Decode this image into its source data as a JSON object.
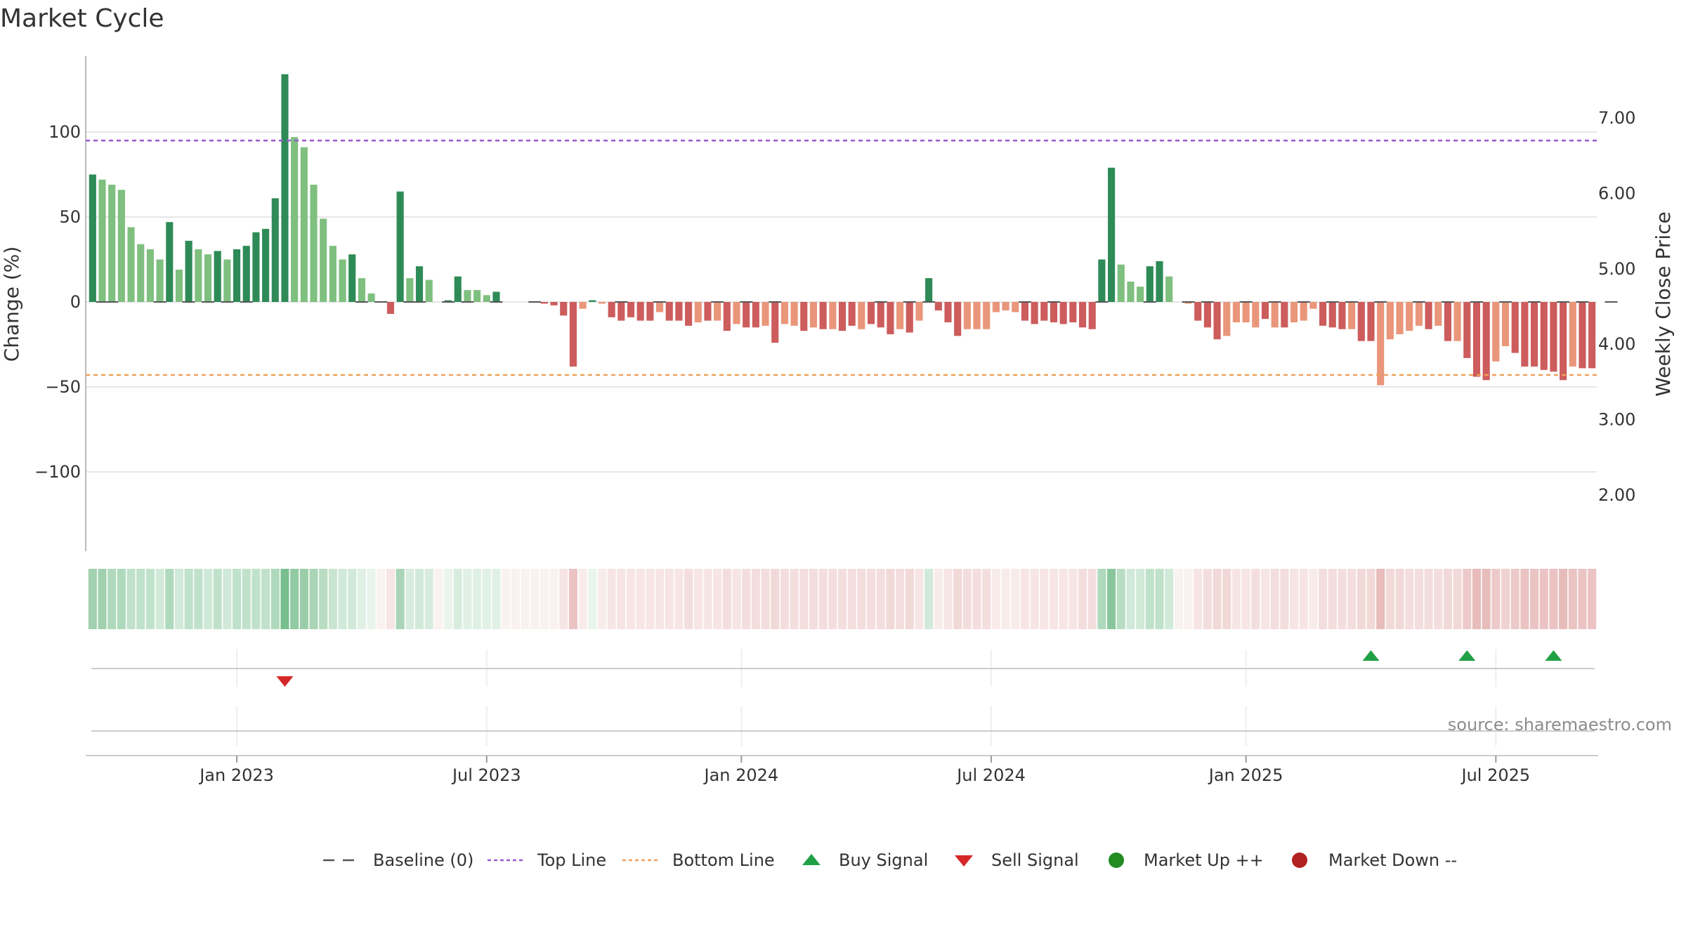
{
  "title": "Market Cycle",
  "source": "source: sharemaestro.com",
  "colors": {
    "up_strong": "#2e8b57",
    "up_light": "#7fbf7f",
    "down_strong": "#cd5c5c",
    "down_light": "#e9967a",
    "top_line": "#9b59d0",
    "bottom_line": "#f0a05a",
    "buy": "#22a046",
    "sell": "#d62728",
    "market_up": "#228b22",
    "market_down": "#b22222"
  },
  "legend": [
    {
      "key": "baseline",
      "label": "Baseline (0)"
    },
    {
      "key": "top",
      "label": "Top Line"
    },
    {
      "key": "bottom",
      "label": "Bottom Line"
    },
    {
      "key": "buy",
      "label": "Buy Signal"
    },
    {
      "key": "sell",
      "label": "Sell Signal"
    },
    {
      "key": "mup",
      "label": "Market Up ++"
    },
    {
      "key": "mdown",
      "label": "Market Down --"
    }
  ],
  "chart_data": {
    "type": "bar",
    "title": "Market Cycle",
    "ylabel": "Change (%)",
    "y2label": "Weekly Close Price",
    "ylim": [
      -145,
      145
    ],
    "y2lim": [
      1.27,
      7.47
    ],
    "yticks": [
      100,
      50,
      0,
      -50,
      -100
    ],
    "ytick_labels": [
      "100",
      "50",
      "0",
      "−50",
      "−100"
    ],
    "y2ticks": [
      7,
      6,
      5,
      4,
      3,
      2
    ],
    "y2tick_labels": [
      "7.00",
      "6.00",
      "5.00",
      "4.00",
      "3.00",
      "2.00"
    ],
    "xtick_labels": [
      "Jan 2023",
      "Jul 2023",
      "Jan 2024",
      "Jul 2024",
      "Jan 2025",
      "Jul 2025"
    ],
    "xtick_weeks": [
      15,
      41,
      67.5,
      93.5,
      120,
      146
    ],
    "top_line": 95,
    "bottom_line": -43,
    "grid": true,
    "legend_position": "bottom",
    "weekly_change": [
      75,
      72,
      69,
      66,
      44,
      34,
      31,
      25,
      47,
      19,
      36,
      31,
      28,
      30,
      25,
      31,
      33,
      41,
      43,
      61,
      134,
      97,
      91,
      69,
      49,
      33,
      25,
      28,
      14,
      5,
      0,
      -7,
      65,
      14,
      21,
      13,
      0,
      1,
      15,
      7,
      7,
      4,
      6,
      0,
      0,
      0,
      0,
      -1,
      -2,
      -8,
      -38,
      -4,
      1,
      -1,
      -9,
      -11,
      -9,
      -11,
      -11,
      -6,
      -11,
      -11,
      -14,
      -12,
      -11,
      -11,
      -17,
      -13,
      -15,
      -15,
      -14,
      -24,
      -13,
      -14,
      -17,
      -15,
      -16,
      -16,
      -17,
      -14,
      -16,
      -13,
      -15,
      -19,
      -16,
      -18,
      -11,
      14,
      -5,
      -12,
      -20,
      -16,
      -16,
      -16,
      -6,
      -5,
      -6,
      -11,
      -13,
      -11,
      -12,
      -13,
      -12,
      -15,
      -16,
      25,
      79,
      22,
      12,
      9,
      21,
      24,
      15,
      0,
      -1,
      -11,
      -15,
      -22,
      -20,
      -12,
      -12,
      -15,
      -10,
      -15,
      -15,
      -12,
      -11,
      -4,
      -14,
      -15,
      -16,
      -16,
      -23,
      -23,
      -49,
      -22,
      -19,
      -17,
      -14,
      -16,
      -14,
      -23,
      -23,
      -33,
      -44,
      -46,
      -35,
      -26,
      -30,
      -38,
      -38,
      -40,
      -41,
      -46,
      -38,
      -39,
      -39
    ],
    "strong_flags": [
      1,
      0,
      0,
      0,
      0,
      0,
      0,
      0,
      1,
      0,
      1,
      0,
      0,
      1,
      0,
      1,
      1,
      1,
      1,
      1,
      1,
      0,
      0,
      0,
      0,
      0,
      0,
      1,
      0,
      0,
      0,
      1,
      1,
      0,
      1,
      0,
      0,
      1,
      1,
      0,
      0,
      0,
      1,
      0,
      0,
      0,
      0,
      1,
      1,
      1,
      1,
      0,
      1,
      0,
      1,
      1,
      1,
      1,
      1,
      0,
      1,
      1,
      1,
      0,
      1,
      0,
      1,
      0,
      1,
      1,
      0,
      1,
      0,
      0,
      1,
      0,
      1,
      0,
      1,
      1,
      0,
      1,
      1,
      1,
      0,
      1,
      0,
      1,
      1,
      1,
      1,
      0,
      0,
      0,
      0,
      0,
      0,
      1,
      1,
      1,
      1,
      1,
      1,
      1,
      1,
      1,
      1,
      0,
      0,
      0,
      1,
      1,
      0,
      0,
      0,
      1,
      1,
      1,
      0,
      0,
      0,
      0,
      1,
      0,
      1,
      0,
      0,
      0,
      1,
      1,
      1,
      0,
      1,
      1,
      0,
      0,
      0,
      0,
      0,
      1,
      0,
      1,
      0,
      1,
      1,
      1,
      0,
      0,
      1,
      1,
      1,
      1,
      1,
      1,
      0,
      1,
      1,
      1
    ],
    "baseline_marks": [
      1,
      2,
      7,
      10,
      12,
      14,
      16,
      28,
      30,
      33,
      34,
      37,
      39,
      42,
      46,
      55,
      59,
      65,
      68,
      71,
      82,
      85,
      87,
      97,
      100,
      105,
      110,
      114,
      116,
      120,
      123,
      126,
      129,
      131,
      134,
      138,
      141,
      144,
      147,
      150,
      153,
      155,
      158
    ],
    "heatmap_intensity": [
      0.6,
      0.6,
      0.5,
      0.5,
      0.4,
      0.4,
      0.4,
      0.3,
      0.5,
      0.3,
      0.4,
      0.4,
      0.3,
      0.4,
      0.3,
      0.4,
      0.4,
      0.4,
      0.4,
      0.5,
      0.85,
      0.7,
      0.65,
      0.55,
      0.45,
      0.35,
      0.3,
      0.3,
      0.2,
      0.15,
      0.1,
      0.2,
      0.55,
      0.25,
      0.3,
      0.25,
      0.1,
      0.15,
      0.25,
      0.2,
      0.2,
      0.2,
      0.2,
      0.1,
      0.1,
      0.1,
      0.1,
      0.1,
      0.1,
      0.2,
      0.45,
      0.15,
      0.15,
      0.15,
      0.2,
      0.2,
      0.2,
      0.2,
      0.2,
      0.2,
      0.2,
      0.2,
      0.25,
      0.2,
      0.2,
      0.2,
      0.25,
      0.2,
      0.25,
      0.25,
      0.25,
      0.3,
      0.25,
      0.25,
      0.25,
      0.25,
      0.25,
      0.25,
      0.25,
      0.25,
      0.25,
      0.25,
      0.25,
      0.3,
      0.25,
      0.3,
      0.2,
      0.3,
      0.15,
      0.2,
      0.3,
      0.25,
      0.25,
      0.25,
      0.15,
      0.15,
      0.15,
      0.2,
      0.2,
      0.2,
      0.2,
      0.2,
      0.2,
      0.25,
      0.25,
      0.5,
      0.75,
      0.45,
      0.3,
      0.3,
      0.4,
      0.4,
      0.3,
      0.1,
      0.1,
      0.2,
      0.25,
      0.3,
      0.3,
      0.2,
      0.2,
      0.25,
      0.2,
      0.25,
      0.25,
      0.2,
      0.2,
      0.15,
      0.25,
      0.25,
      0.25,
      0.25,
      0.3,
      0.3,
      0.5,
      0.3,
      0.3,
      0.25,
      0.25,
      0.25,
      0.25,
      0.3,
      0.3,
      0.4,
      0.5,
      0.5,
      0.4,
      0.35,
      0.4,
      0.45,
      0.45,
      0.45,
      0.45,
      0.5,
      0.45,
      0.45,
      0.45
    ],
    "buy_signals": [
      133,
      143,
      152
    ],
    "sell_signals": [
      20
    ]
  }
}
